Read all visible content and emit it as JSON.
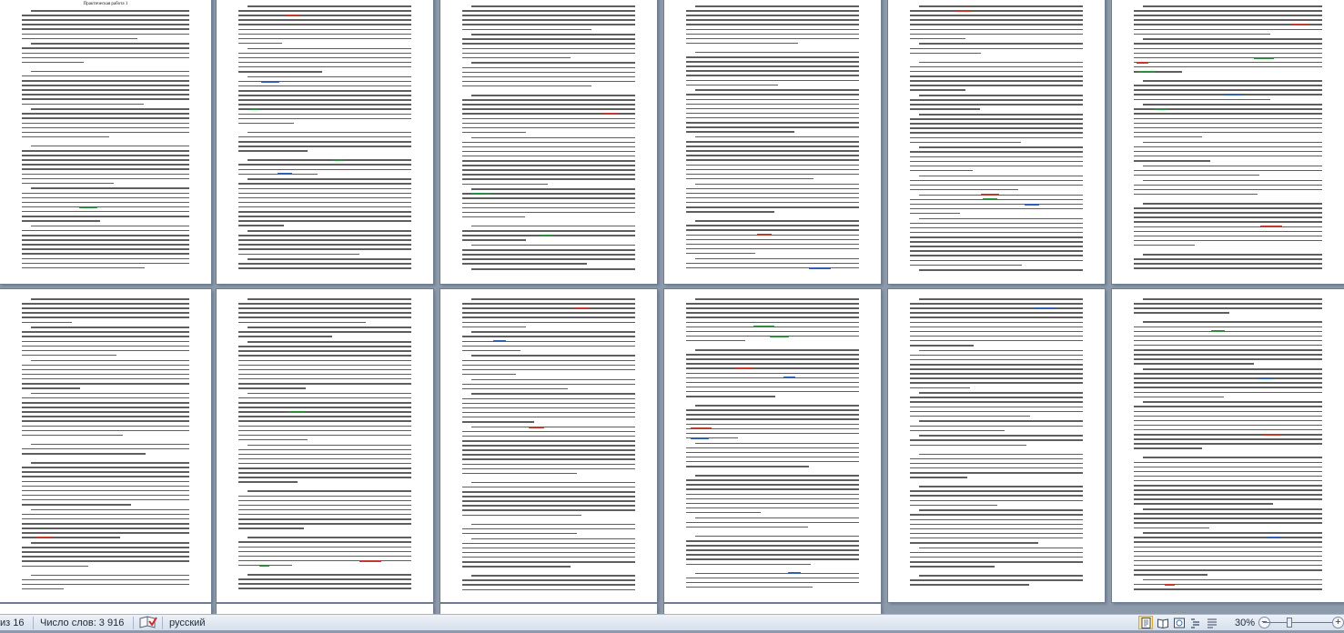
{
  "document": {
    "page_title": "Практическая работа 1",
    "highlight_colors": {
      "red": "#c0392b",
      "green": "#2e8b3d",
      "blue": "#2f5fb3"
    }
  },
  "status_bar": {
    "page_indicator": "из 16",
    "word_count": "Число слов: 3 916",
    "language": "русский",
    "zoom_level": "30%",
    "zoom_out_symbol": "−",
    "zoom_in_symbol": "+",
    "proofing_icon": "spellcheck-book-icon",
    "view_icons": [
      "print-layout-icon",
      "full-screen-reading-icon",
      "web-layout-icon",
      "outline-icon",
      "draft-icon"
    ]
  }
}
